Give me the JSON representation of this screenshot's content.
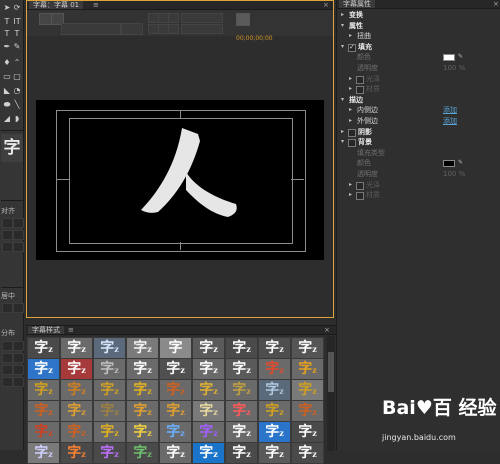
{
  "title_panel": {
    "tab_label": "字幕：字幕 01",
    "tab_menu_glyph": "≡",
    "close_glyph": "×",
    "timecode": "00;00;00;00",
    "canvas_text": "人"
  },
  "tools": {
    "text_tools": [
      "T",
      "IT",
      "T",
      "T"
    ],
    "align_label": "对齐",
    "center_label": "居中",
    "distribute_label": "分布",
    "sample_glyph": "字"
  },
  "properties": {
    "tab_label": "字幕属性",
    "close_glyph": "×",
    "rows": [
      {
        "indent": 0,
        "arrow": "▸",
        "label": "变换",
        "style": "b"
      },
      {
        "indent": 0,
        "arrow": "▾",
        "label": "属性",
        "style": "b"
      },
      {
        "indent": 1,
        "arrow": "▸",
        "label": "扭曲",
        "style": "n"
      },
      {
        "indent": 0,
        "arrow": "▾",
        "check": true,
        "label": "填充",
        "style": "b"
      },
      {
        "indent": 1,
        "label": "颜色",
        "style": "dim",
        "swatch": "#ffffff"
      },
      {
        "indent": 1,
        "label": "透明度",
        "style": "dim",
        "value": "100 %"
      },
      {
        "indent": 1,
        "arrow": "▸",
        "check": false,
        "label": "光泽",
        "style": "dim2"
      },
      {
        "indent": 1,
        "arrow": "▸",
        "check": false,
        "label": "材质",
        "style": "dim2"
      },
      {
        "indent": 0,
        "arrow": "▾",
        "label": "描边",
        "style": "b"
      },
      {
        "indent": 1,
        "arrow": "▸",
        "label": "内侧边",
        "style": "n",
        "link": "添加"
      },
      {
        "indent": 1,
        "arrow": "▸",
        "label": "外侧边",
        "style": "n",
        "link": "添加"
      },
      {
        "indent": 0,
        "arrow": "▸",
        "check": false,
        "label": "阴影",
        "style": "b"
      },
      {
        "indent": 0,
        "arrow": "▾",
        "check": false,
        "label": "背景",
        "style": "b"
      },
      {
        "indent": 1,
        "label": "填充类型",
        "style": "dim"
      },
      {
        "indent": 1,
        "label": "颜色",
        "style": "dim",
        "swatch": "#000000"
      },
      {
        "indent": 1,
        "label": "透明度",
        "style": "dim",
        "value": "100 %"
      },
      {
        "indent": 1,
        "arrow": "▸",
        "check": false,
        "label": "光泽",
        "style": "dim2"
      },
      {
        "indent": 1,
        "arrow": "▸",
        "check": false,
        "label": "材质",
        "style": "dim2"
      }
    ]
  },
  "styles_panel": {
    "tab_label": "字幕样式",
    "tab_menu_glyph": "≡",
    "close_glyph": "×",
    "cells": [
      {
        "t": "字",
        "s": "z",
        "fg": "#ffffff",
        "bg": "#4a4a4a"
      },
      {
        "t": "字",
        "s": "z",
        "fg": "#ffffff",
        "bg": "#6a6a6a"
      },
      {
        "t": "字",
        "s": "z",
        "fg": "#d8e6ff",
        "bg": "#5a6a7a"
      },
      {
        "t": "字",
        "s": "z",
        "fg": "#f2f2f2",
        "bg": "#7a7a7a"
      },
      {
        "t": "字",
        "s": "",
        "fg": "#ffffff",
        "bg": "#8a8a8a"
      },
      {
        "t": "字",
        "s": "z",
        "fg": "#ffffff",
        "bg": "#5a5a5a"
      },
      {
        "t": "字",
        "s": "z",
        "fg": "#ffffff",
        "bg": "#4a4a4a"
      },
      {
        "t": "字",
        "s": "z",
        "fg": "#ffffff",
        "bg": "#4e4e4e"
      },
      {
        "t": "字",
        "s": "z",
        "fg": "#ffffff",
        "bg": "#555555"
      },
      {
        "t": "字",
        "s": "z",
        "fg": "#ffffff",
        "bg": "#2e74c9"
      },
      {
        "t": "字",
        "s": "z",
        "fg": "#ffffff",
        "bg": "#a63a3a"
      },
      {
        "t": "字",
        "s": "z",
        "fg": "#bfbfbf",
        "bg": "#6a6a6a"
      },
      {
        "t": "字",
        "s": "z",
        "fg": "#ffffff",
        "bg": "#6a6a6a"
      },
      {
        "t": "字",
        "s": "z",
        "fg": "#ffffff",
        "bg": "#505050"
      },
      {
        "t": "字",
        "s": "z",
        "fg": "#ffffff",
        "bg": "#6a6a6a"
      },
      {
        "t": "字",
        "s": "z",
        "fg": "#ffffff",
        "bg": "#5a5a5a"
      },
      {
        "t": "字",
        "s": "z",
        "fg": "#e34a2a",
        "bg": "#6a6a6a"
      },
      {
        "t": "字",
        "s": "z",
        "fg": "#e8a020",
        "bg": "#6a6a6a"
      },
      {
        "t": "字",
        "s": "z",
        "fg": "#d0a020",
        "bg": "#6a6a6a"
      },
      {
        "t": "字",
        "s": "z",
        "fg": "#d08020",
        "bg": "#6a6a6a"
      },
      {
        "t": "字",
        "s": "z",
        "fg": "#d0a020",
        "bg": "#6a6a6a"
      },
      {
        "t": "字",
        "s": "z",
        "fg": "#e0b020",
        "bg": "#6a6a6a"
      },
      {
        "t": "字",
        "s": "z",
        "fg": "#d06020",
        "bg": "#6a6a6a"
      },
      {
        "t": "字",
        "s": "z",
        "fg": "#e0b030",
        "bg": "#6a6a6a"
      },
      {
        "t": "字",
        "s": "z",
        "fg": "#c0a040",
        "bg": "#6a6a6a"
      },
      {
        "t": "字",
        "s": "z",
        "fg": "#b0c8e0",
        "bg": "#5a6a7a"
      },
      {
        "t": "字",
        "s": "z",
        "fg": "#d0a020",
        "bg": "#7a7a7a"
      },
      {
        "t": "字",
        "s": "z",
        "fg": "#d06020",
        "bg": "#6a6a6a"
      },
      {
        "t": "字",
        "s": "z",
        "fg": "#e0a030",
        "bg": "#6a6a6a"
      },
      {
        "t": "字",
        "s": "z",
        "fg": "#a08040",
        "bg": "#6a6a6a"
      },
      {
        "t": "字",
        "s": "z",
        "fg": "#e0a030",
        "bg": "#6a6a6a"
      },
      {
        "t": "字",
        "s": "z",
        "fg": "#e0a030",
        "bg": "#6a6a6a"
      },
      {
        "t": "字",
        "s": "z",
        "fg": "#e8d8a0",
        "bg": "#7a7a7a"
      },
      {
        "t": "字",
        "s": "z",
        "fg": "#ff5a5a",
        "bg": "#6a6a6a"
      },
      {
        "t": "字",
        "s": "z",
        "fg": "#d0a020",
        "bg": "#6a6a6a"
      },
      {
        "t": "字",
        "s": "z",
        "fg": "#d06020",
        "bg": "#6a6a6a"
      },
      {
        "t": "字",
        "s": "z",
        "fg": "#d04020",
        "bg": "#6a6a6a"
      },
      {
        "t": "字",
        "s": "z",
        "fg": "#d06020",
        "bg": "#6a6a6a"
      },
      {
        "t": "字",
        "s": "z",
        "fg": "#e0b020",
        "bg": "#6a6a6a"
      },
      {
        "t": "字",
        "s": "z",
        "fg": "#f0d040",
        "bg": "#6a6a6a"
      },
      {
        "t": "字",
        "s": "z",
        "fg": "#6ab0ff",
        "bg": "#6a6a6a"
      },
      {
        "t": "字",
        "s": "z",
        "fg": "#a060ff",
        "bg": "#6a6a6a"
      },
      {
        "t": "字",
        "s": "z",
        "fg": "#ffffff",
        "bg": "#6a6a6a"
      },
      {
        "t": "字",
        "s": "z",
        "fg": "#ffffff",
        "bg": "#2a74c9"
      },
      {
        "t": "字",
        "s": "z",
        "fg": "#ffffff",
        "bg": "#4a4a4a"
      },
      {
        "t": "字",
        "s": "z",
        "fg": "#d0d0ff",
        "bg": "#7a7a7a"
      },
      {
        "t": "字",
        "s": "z",
        "fg": "#ff8030",
        "bg": "#4a4a4a"
      },
      {
        "t": "字",
        "s": "z",
        "fg": "#c070ff",
        "bg": "#4a4a4a"
      },
      {
        "t": "字",
        "s": "z",
        "fg": "#70c070",
        "bg": "#4a4a4a"
      },
      {
        "t": "字",
        "s": "z",
        "fg": "#ffffff",
        "bg": "#6a6a6a"
      },
      {
        "t": "字",
        "s": "z",
        "fg": "#ffffff",
        "bg": "#1a74c9"
      },
      {
        "t": "字",
        "s": "z",
        "fg": "#ffffff",
        "bg": "#4a4a4a"
      },
      {
        "t": "字",
        "s": "z",
        "fg": "#ffffff",
        "bg": "#5a5a5a"
      },
      {
        "t": "字",
        "s": "z",
        "fg": "#ffffff",
        "bg": "#4a4a4a"
      }
    ]
  },
  "watermark": {
    "logo": "Bai♥百 经验",
    "url": "jingyan.baidu.com"
  },
  "colors": {
    "panel_focus_border": "#e0a33a",
    "link": "#5aa4d6",
    "timecode": "#d49a2a"
  }
}
